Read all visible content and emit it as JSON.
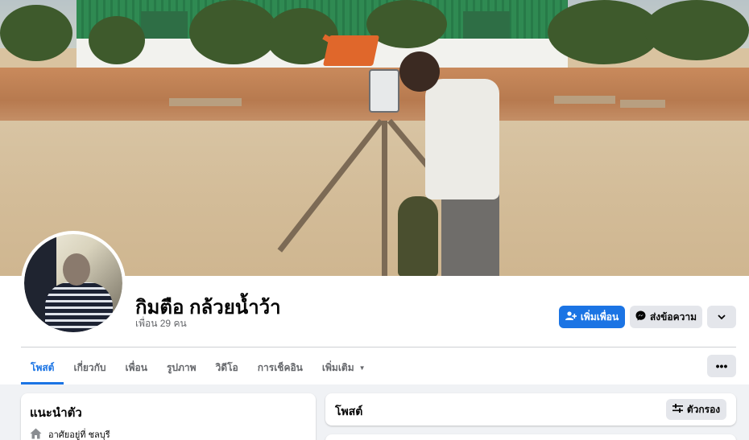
{
  "profile": {
    "name": "กิมตือ กล้วยน้ำว้า",
    "friends_count": "เพื่อน 29 คน"
  },
  "actions": {
    "add_friend": "เพิ่มเพื่อน",
    "message": "ส่งข้อความ",
    "more_icon": "chevron-down-icon",
    "options_icon": "ellipsis-icon"
  },
  "tabs": [
    {
      "label": "โพสต์",
      "active": true
    },
    {
      "label": "เกี่ยวกับ",
      "active": false
    },
    {
      "label": "เพื่อน",
      "active": false
    },
    {
      "label": "รูปภาพ",
      "active": false
    },
    {
      "label": "วิดีโอ",
      "active": false
    },
    {
      "label": "การเช็คอิน",
      "active": false
    },
    {
      "label": "เพิ่มเติม",
      "active": false
    }
  ],
  "intro": {
    "title": "แนะนำตัว",
    "lives_in": "อาศัยอยู่ที่ ชลบุรี"
  },
  "posts": {
    "title": "โพสต์",
    "filter": "ตัวกรอง"
  },
  "colors": {
    "accent": "#1b74e4",
    "secondary_button": "#e4e6eb",
    "page_background": "#f0f2f5"
  }
}
